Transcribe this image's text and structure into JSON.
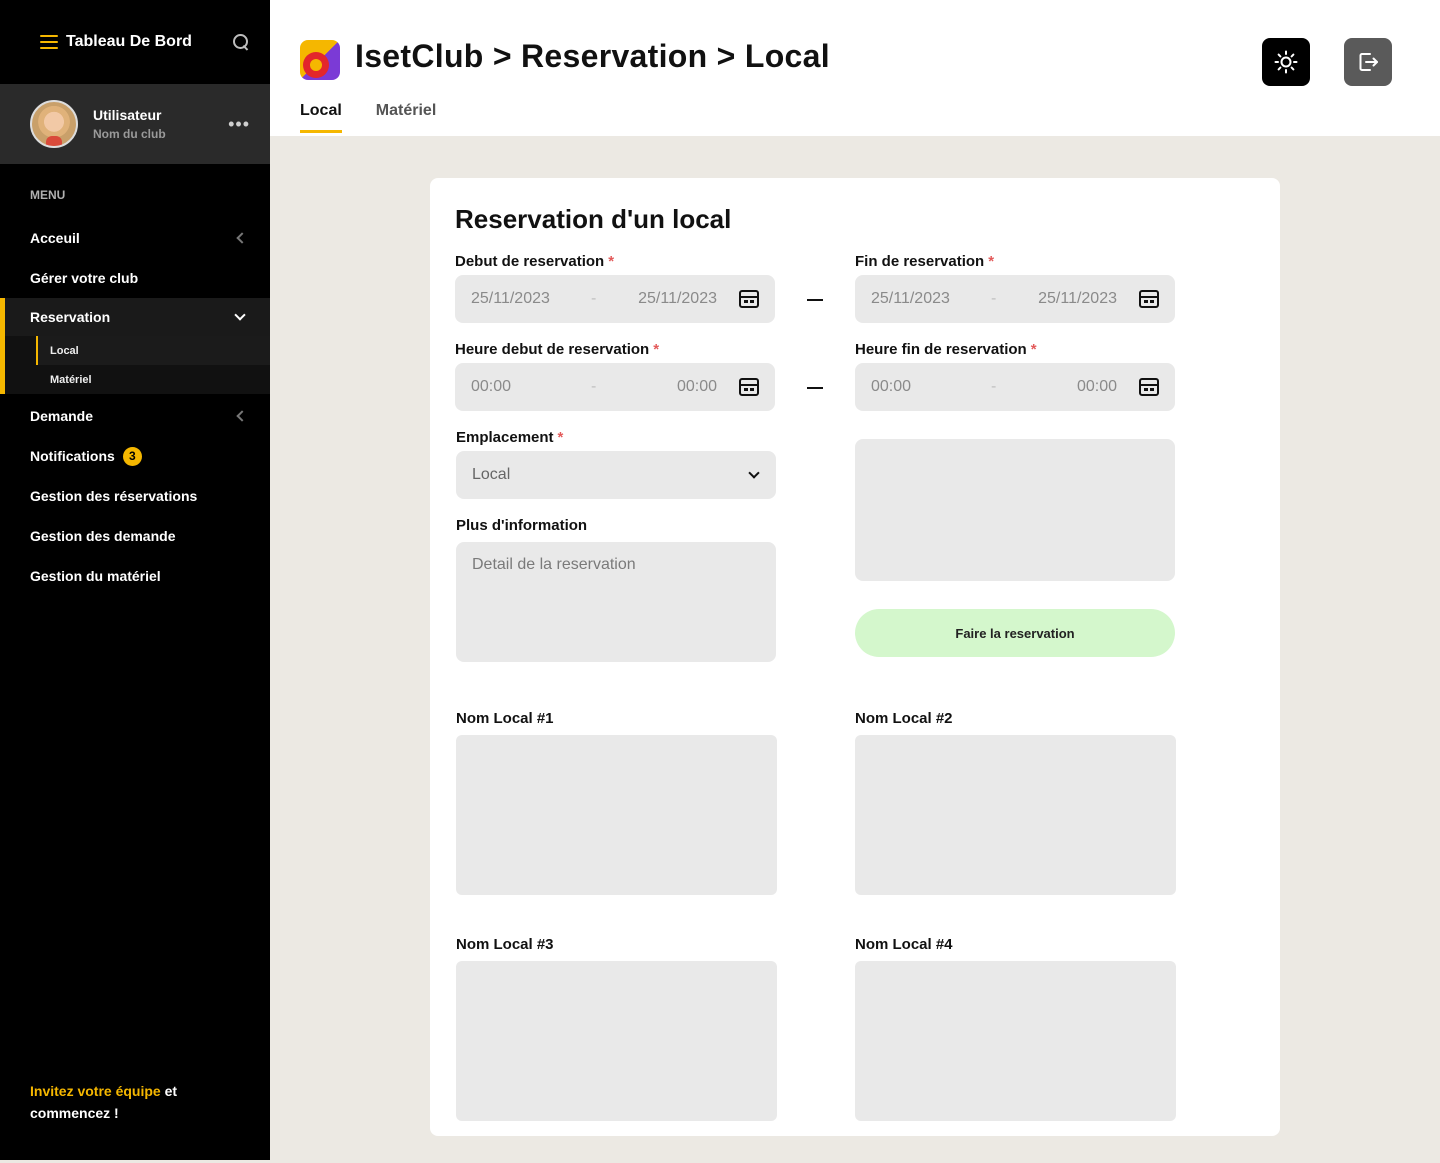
{
  "sidebar": {
    "brand": "Tableau De Bord",
    "user": {
      "name": "Utilisateur",
      "club": "Nom du club"
    },
    "menu_label": "MENU",
    "items": [
      {
        "label": "Acceuil"
      },
      {
        "label": "Gérer votre club"
      },
      {
        "label": "Reservation"
      },
      {
        "label": "Demande"
      },
      {
        "label": "Notifications",
        "badge": "3"
      },
      {
        "label": "Gestion des réservations"
      },
      {
        "label": "Gestion des demande"
      },
      {
        "label": "Gestion du matériel"
      }
    ],
    "subitems": [
      {
        "label": "Local"
      },
      {
        "label": "Matériel"
      }
    ],
    "invite": {
      "link": "Invitez votre équipe",
      "rest1": " et",
      "rest2": "commencez !"
    }
  },
  "header": {
    "title": "IsetClub > Reservation > Local",
    "tabs": [
      {
        "label": "Local"
      },
      {
        "label": "Matériel"
      }
    ]
  },
  "form": {
    "title": "Reservation d'un local",
    "debut_label": "Debut de reservation",
    "fin_label": "Fin de reservation",
    "heure_debut_label": "Heure debut de reservation",
    "heure_fin_label": "Heure fin de reservation",
    "required_mark": "*",
    "debut_start": "25/11/2023",
    "debut_end": "25/11/2023",
    "range_sep": "-",
    "fin_start": "25/11/2023",
    "fin_end": "25/11/2023",
    "heure_debut_start": "00:00",
    "heure_debut_end": "00:00",
    "heure_fin_start": "00:00",
    "heure_fin_end": "00:00",
    "emplacement_label": "Emplacement",
    "emplacement_value": "Local",
    "info_label": "Plus d'information",
    "info_placeholder": "Detail de la reservation",
    "submit_label": "Faire la reservation"
  },
  "locaux": [
    {
      "name": "Nom Local #1"
    },
    {
      "name": "Nom Local #2"
    },
    {
      "name": "Nom Local #3"
    },
    {
      "name": "Nom Local #4"
    }
  ],
  "colors": {
    "accent": "#f5b700",
    "submit_bg": "#d4f7cc",
    "sidebar_bg": "#000000",
    "page_bg": "#ece9e3"
  },
  "icons": [
    "menu-icon",
    "search-icon",
    "more-icon",
    "chevron-left-icon",
    "chevron-down-icon",
    "sun-icon",
    "logout-icon",
    "calendar-icon"
  ]
}
